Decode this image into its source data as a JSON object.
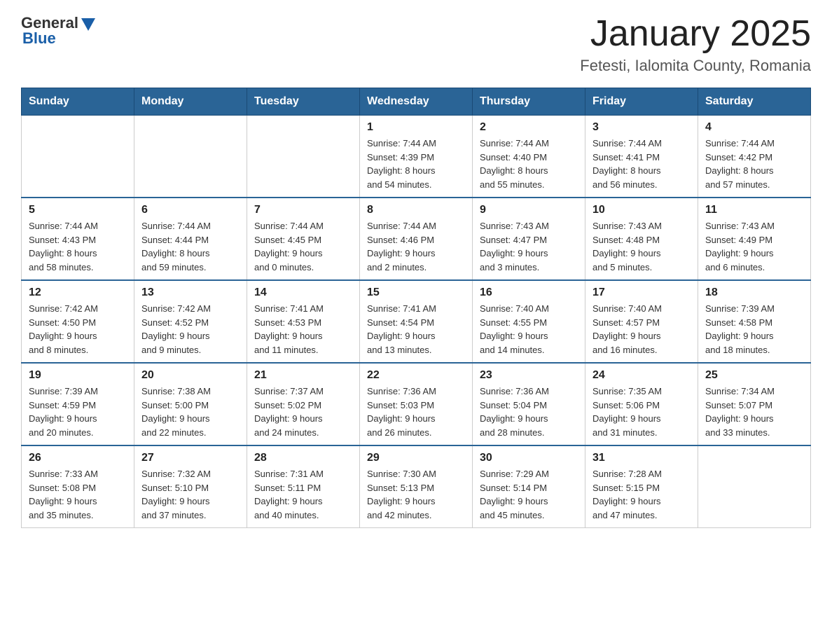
{
  "logo": {
    "name_part1": "General",
    "name_part2": "Blue"
  },
  "header": {
    "month": "January 2025",
    "location": "Fetesti, Ialomita County, Romania"
  },
  "weekdays": [
    "Sunday",
    "Monday",
    "Tuesday",
    "Wednesday",
    "Thursday",
    "Friday",
    "Saturday"
  ],
  "weeks": [
    [
      {
        "day": "",
        "info": ""
      },
      {
        "day": "",
        "info": ""
      },
      {
        "day": "",
        "info": ""
      },
      {
        "day": "1",
        "info": "Sunrise: 7:44 AM\nSunset: 4:39 PM\nDaylight: 8 hours\nand 54 minutes."
      },
      {
        "day": "2",
        "info": "Sunrise: 7:44 AM\nSunset: 4:40 PM\nDaylight: 8 hours\nand 55 minutes."
      },
      {
        "day": "3",
        "info": "Sunrise: 7:44 AM\nSunset: 4:41 PM\nDaylight: 8 hours\nand 56 minutes."
      },
      {
        "day": "4",
        "info": "Sunrise: 7:44 AM\nSunset: 4:42 PM\nDaylight: 8 hours\nand 57 minutes."
      }
    ],
    [
      {
        "day": "5",
        "info": "Sunrise: 7:44 AM\nSunset: 4:43 PM\nDaylight: 8 hours\nand 58 minutes."
      },
      {
        "day": "6",
        "info": "Sunrise: 7:44 AM\nSunset: 4:44 PM\nDaylight: 8 hours\nand 59 minutes."
      },
      {
        "day": "7",
        "info": "Sunrise: 7:44 AM\nSunset: 4:45 PM\nDaylight: 9 hours\nand 0 minutes."
      },
      {
        "day": "8",
        "info": "Sunrise: 7:44 AM\nSunset: 4:46 PM\nDaylight: 9 hours\nand 2 minutes."
      },
      {
        "day": "9",
        "info": "Sunrise: 7:43 AM\nSunset: 4:47 PM\nDaylight: 9 hours\nand 3 minutes."
      },
      {
        "day": "10",
        "info": "Sunrise: 7:43 AM\nSunset: 4:48 PM\nDaylight: 9 hours\nand 5 minutes."
      },
      {
        "day": "11",
        "info": "Sunrise: 7:43 AM\nSunset: 4:49 PM\nDaylight: 9 hours\nand 6 minutes."
      }
    ],
    [
      {
        "day": "12",
        "info": "Sunrise: 7:42 AM\nSunset: 4:50 PM\nDaylight: 9 hours\nand 8 minutes."
      },
      {
        "day": "13",
        "info": "Sunrise: 7:42 AM\nSunset: 4:52 PM\nDaylight: 9 hours\nand 9 minutes."
      },
      {
        "day": "14",
        "info": "Sunrise: 7:41 AM\nSunset: 4:53 PM\nDaylight: 9 hours\nand 11 minutes."
      },
      {
        "day": "15",
        "info": "Sunrise: 7:41 AM\nSunset: 4:54 PM\nDaylight: 9 hours\nand 13 minutes."
      },
      {
        "day": "16",
        "info": "Sunrise: 7:40 AM\nSunset: 4:55 PM\nDaylight: 9 hours\nand 14 minutes."
      },
      {
        "day": "17",
        "info": "Sunrise: 7:40 AM\nSunset: 4:57 PM\nDaylight: 9 hours\nand 16 minutes."
      },
      {
        "day": "18",
        "info": "Sunrise: 7:39 AM\nSunset: 4:58 PM\nDaylight: 9 hours\nand 18 minutes."
      }
    ],
    [
      {
        "day": "19",
        "info": "Sunrise: 7:39 AM\nSunset: 4:59 PM\nDaylight: 9 hours\nand 20 minutes."
      },
      {
        "day": "20",
        "info": "Sunrise: 7:38 AM\nSunset: 5:00 PM\nDaylight: 9 hours\nand 22 minutes."
      },
      {
        "day": "21",
        "info": "Sunrise: 7:37 AM\nSunset: 5:02 PM\nDaylight: 9 hours\nand 24 minutes."
      },
      {
        "day": "22",
        "info": "Sunrise: 7:36 AM\nSunset: 5:03 PM\nDaylight: 9 hours\nand 26 minutes."
      },
      {
        "day": "23",
        "info": "Sunrise: 7:36 AM\nSunset: 5:04 PM\nDaylight: 9 hours\nand 28 minutes."
      },
      {
        "day": "24",
        "info": "Sunrise: 7:35 AM\nSunset: 5:06 PM\nDaylight: 9 hours\nand 31 minutes."
      },
      {
        "day": "25",
        "info": "Sunrise: 7:34 AM\nSunset: 5:07 PM\nDaylight: 9 hours\nand 33 minutes."
      }
    ],
    [
      {
        "day": "26",
        "info": "Sunrise: 7:33 AM\nSunset: 5:08 PM\nDaylight: 9 hours\nand 35 minutes."
      },
      {
        "day": "27",
        "info": "Sunrise: 7:32 AM\nSunset: 5:10 PM\nDaylight: 9 hours\nand 37 minutes."
      },
      {
        "day": "28",
        "info": "Sunrise: 7:31 AM\nSunset: 5:11 PM\nDaylight: 9 hours\nand 40 minutes."
      },
      {
        "day": "29",
        "info": "Sunrise: 7:30 AM\nSunset: 5:13 PM\nDaylight: 9 hours\nand 42 minutes."
      },
      {
        "day": "30",
        "info": "Sunrise: 7:29 AM\nSunset: 5:14 PM\nDaylight: 9 hours\nand 45 minutes."
      },
      {
        "day": "31",
        "info": "Sunrise: 7:28 AM\nSunset: 5:15 PM\nDaylight: 9 hours\nand 47 minutes."
      },
      {
        "day": "",
        "info": ""
      }
    ]
  ]
}
